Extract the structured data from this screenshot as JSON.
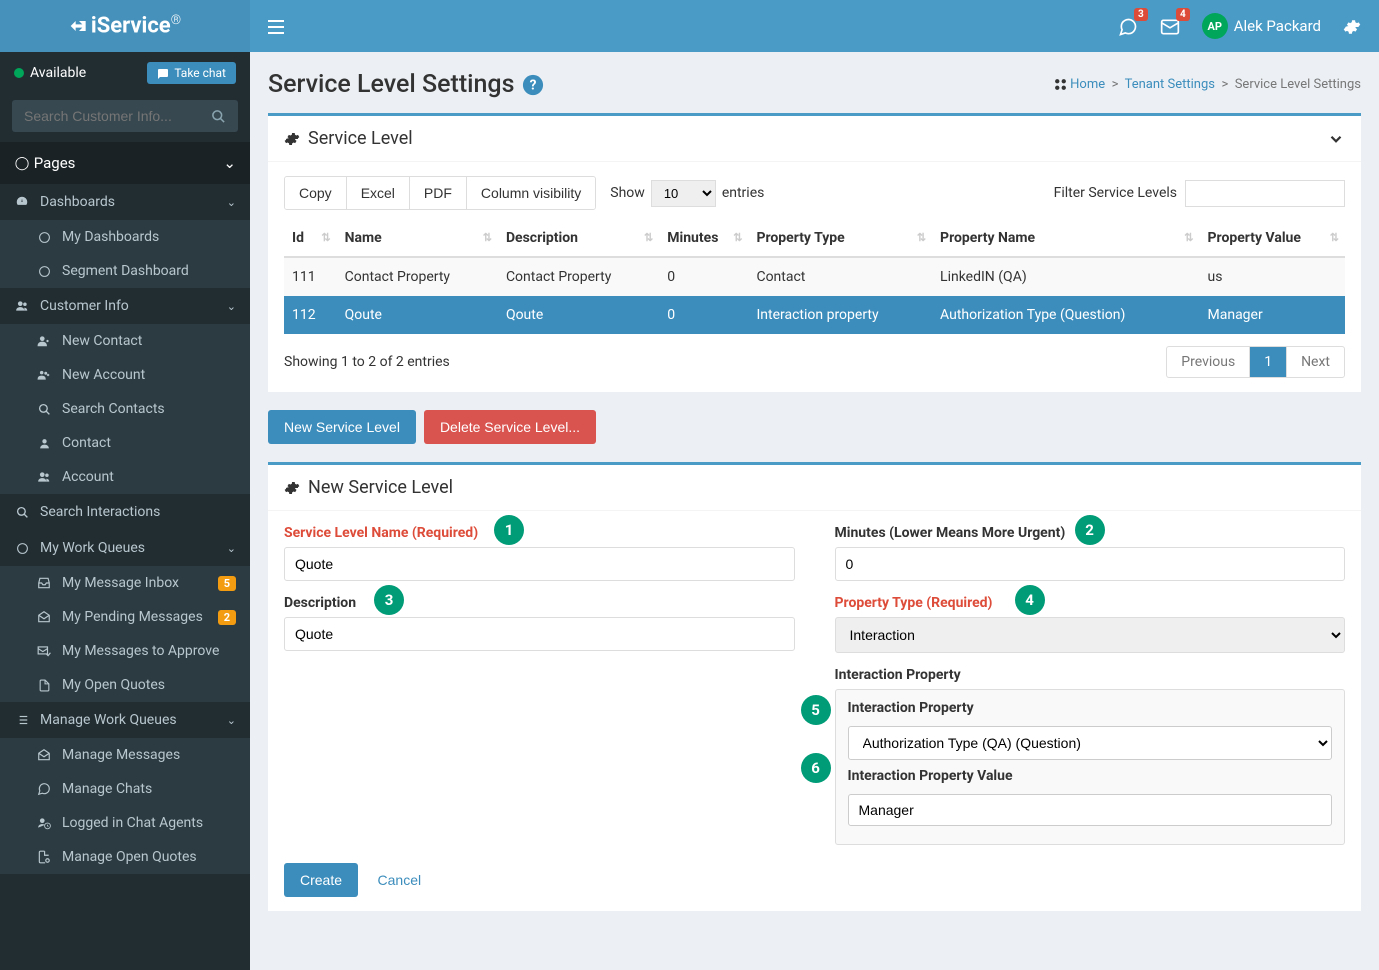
{
  "brand": {
    "name": "iService",
    "reg": "®"
  },
  "header": {
    "user_initials": "AP",
    "user_name": "Alek Packard",
    "chat_badge": "3",
    "mail_badge": "4"
  },
  "sidebar": {
    "status": "Available",
    "take_chat": "Take chat",
    "search_placeholder": "Search Customer Info...",
    "pages_label": "Pages",
    "items": [
      {
        "label": "Dashboards",
        "icon": "tachometer",
        "expandable": true,
        "subs": [
          {
            "label": "My Dashboards",
            "icon": "circle-o"
          },
          {
            "label": "Segment Dashboard",
            "icon": "circle-o"
          }
        ]
      },
      {
        "label": "Customer Info",
        "icon": "users",
        "expandable": true,
        "subs": [
          {
            "label": "New Contact",
            "icon": "user-plus"
          },
          {
            "label": "New Account",
            "icon": "users-plus"
          },
          {
            "label": "Search Contacts",
            "icon": "search"
          },
          {
            "label": "Contact",
            "icon": "user"
          },
          {
            "label": "Account",
            "icon": "users"
          }
        ]
      },
      {
        "label": "Search Interactions",
        "icon": "search"
      },
      {
        "label": "My Work Queues",
        "icon": "circle-o",
        "expandable": true,
        "subs": [
          {
            "label": "My Message Inbox",
            "icon": "inbox",
            "badge": "5"
          },
          {
            "label": "My Pending Messages",
            "icon": "envelope-open",
            "badge": "2"
          },
          {
            "label": "My Messages to Approve",
            "icon": "check-envelope"
          },
          {
            "label": "My Open Quotes",
            "icon": "file"
          }
        ]
      },
      {
        "label": "Manage Work Queues",
        "icon": "list",
        "expandable": true,
        "subs": [
          {
            "label": "Manage Messages",
            "icon": "envelope-open"
          },
          {
            "label": "Manage Chats",
            "icon": "comments"
          },
          {
            "label": "Logged in Chat Agents",
            "icon": "user-clock"
          },
          {
            "label": "Manage Open Quotes",
            "icon": "file-gear"
          }
        ]
      }
    ]
  },
  "page": {
    "title": "Service Level Settings",
    "breadcrumb": {
      "home": "Home",
      "l1": "Tenant Settings",
      "l2": "Service Level Settings"
    }
  },
  "panel1": {
    "title": "Service Level",
    "buttons": {
      "copy": "Copy",
      "excel": "Excel",
      "pdf": "PDF",
      "colvis": "Column visibility"
    },
    "show": "Show",
    "show_val": "10",
    "entries": "entries",
    "filter_label": "Filter Service Levels",
    "cols": {
      "id": "Id",
      "name": "Name",
      "desc": "Description",
      "min": "Minutes",
      "ptype": "Property Type",
      "pname": "Property Name",
      "pval": "Property Value"
    },
    "rows": [
      {
        "id": "111",
        "name": "Contact Property",
        "desc": "Contact Property",
        "min": "0",
        "ptype": "Contact",
        "pname": "LinkedIN (QA)",
        "pval": "us"
      },
      {
        "id": "112",
        "name": "Qoute",
        "desc": "Qoute",
        "min": "0",
        "ptype": "Interaction property",
        "pname": "Authorization Type (Question)",
        "pval": "Manager"
      }
    ],
    "info": "Showing 1 to 2 of 2 entries",
    "pager": {
      "prev": "Previous",
      "page": "1",
      "next": "Next"
    }
  },
  "actions": {
    "new": "New Service Level",
    "delete": "Delete Service Level..."
  },
  "form": {
    "title": "New Service Level",
    "f1": {
      "label": "Service Level Name (Required)",
      "val": "Quote"
    },
    "f2": {
      "label": "Minutes (Lower Means More Urgent)",
      "val": "0"
    },
    "f3": {
      "label": "Description",
      "val": "Quote"
    },
    "f4": {
      "label": "Property Type (Required)",
      "val": "Interaction"
    },
    "f5": {
      "group": "Interaction Property",
      "label": "Interaction Property",
      "val": "Authorization Type (QA) (Question)"
    },
    "f6": {
      "label": "Interaction Property Value",
      "val": "Manager"
    },
    "create": "Create",
    "cancel": "Cancel"
  },
  "callouts": {
    "c1": "1",
    "c2": "2",
    "c3": "3",
    "c4": "4",
    "c5": "5",
    "c6": "6"
  }
}
